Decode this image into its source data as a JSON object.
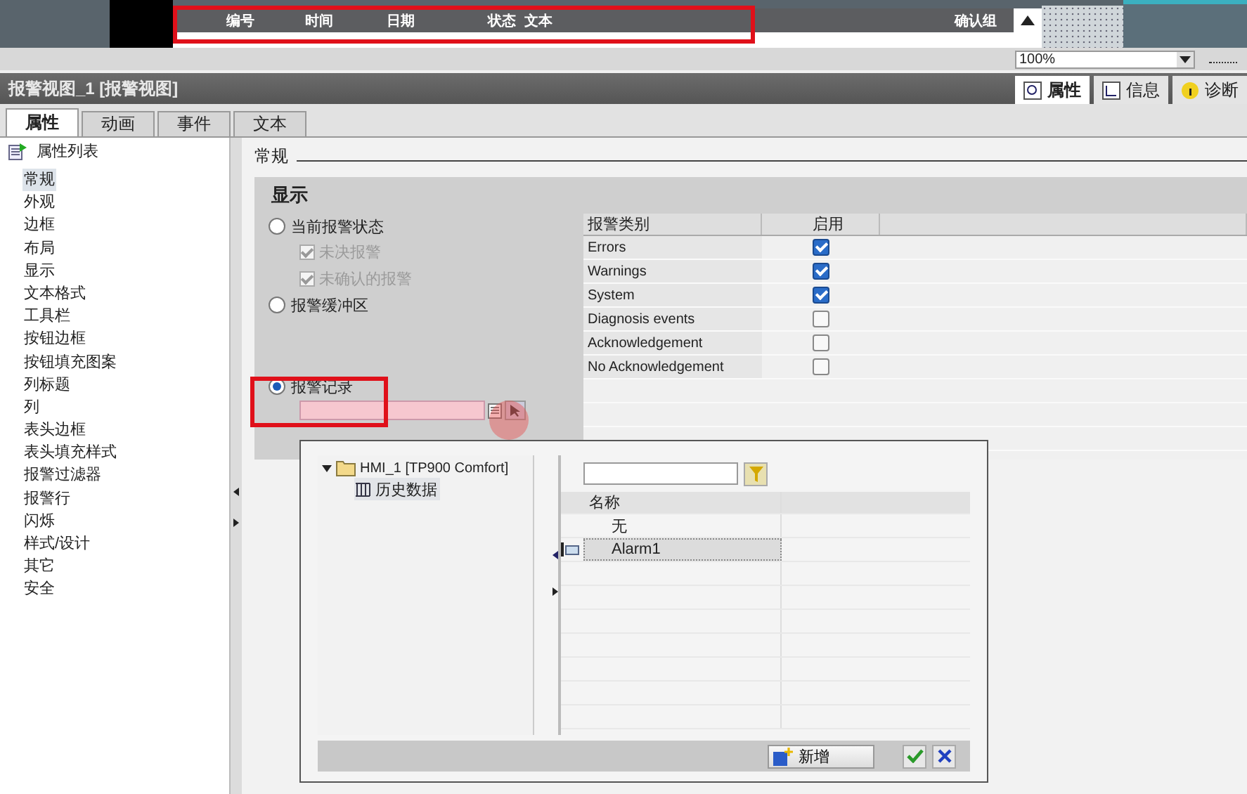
{
  "preview": {
    "columns": [
      "编号",
      "时间",
      "日期",
      "状态",
      "文本"
    ],
    "last_column": "确认组",
    "zoom": "100%"
  },
  "inspector": {
    "title": "报警视图_1 [报警视图]",
    "panel_tabs": [
      {
        "label": "属性",
        "selected": true
      },
      {
        "label": "信息",
        "selected": false
      },
      {
        "label": "诊断",
        "selected": false
      }
    ]
  },
  "tabs": [
    {
      "label": "属性",
      "selected": true
    },
    {
      "label": "动画",
      "selected": false
    },
    {
      "label": "事件",
      "selected": false
    },
    {
      "label": "文本",
      "selected": false
    }
  ],
  "sidebar": {
    "header": "属性列表",
    "items": [
      {
        "label": "常规",
        "selected": true
      },
      {
        "label": "外观",
        "selected": false
      },
      {
        "label": "边框",
        "selected": false
      },
      {
        "label": "布局",
        "selected": false
      },
      {
        "label": "显示",
        "selected": false
      },
      {
        "label": "文本格式",
        "selected": false
      },
      {
        "label": "工具栏",
        "selected": false
      },
      {
        "label": "按钮边框",
        "selected": false
      },
      {
        "label": "按钮填充图案",
        "selected": false
      },
      {
        "label": "列标题",
        "selected": false
      },
      {
        "label": "列",
        "selected": false
      },
      {
        "label": "表头边框",
        "selected": false
      },
      {
        "label": "表头填充样式",
        "selected": false
      },
      {
        "label": "报警过滤器",
        "selected": false
      },
      {
        "label": "报警行",
        "selected": false
      },
      {
        "label": "闪烁",
        "selected": false
      },
      {
        "label": "样式/设计",
        "selected": false
      },
      {
        "label": "其它",
        "selected": false
      },
      {
        "label": "安全",
        "selected": false
      }
    ]
  },
  "section": {
    "title": "常规",
    "group_title": "显示",
    "options": [
      {
        "label": "当前报警状态",
        "selected": false,
        "children": [
          {
            "label": "未决报警",
            "checked": true,
            "disabled": true
          },
          {
            "label": "未确认的报警",
            "checked": true,
            "disabled": true
          }
        ]
      },
      {
        "label": "报警缓冲区",
        "selected": false
      },
      {
        "label": "报警记录",
        "selected": true
      }
    ],
    "class_table": {
      "columns": [
        "报警类别",
        "启用"
      ],
      "rows": [
        {
          "name": "Errors",
          "checked": true
        },
        {
          "name": "Warnings",
          "checked": true
        },
        {
          "name": "System",
          "checked": true
        },
        {
          "name": "Diagnosis events",
          "checked": false
        },
        {
          "name": "Acknowledgement",
          "checked": false
        },
        {
          "name": "No Acknowledgement",
          "checked": false
        }
      ]
    }
  },
  "picker": {
    "tree": {
      "label": "HMI_1 [TP900 Comfort]",
      "expanded": true,
      "children": [
        {
          "label": "历史数据",
          "selected": true
        }
      ]
    },
    "list": {
      "columns": [
        "名称"
      ],
      "rows": [
        {
          "name": "无",
          "selected": false
        },
        {
          "name": "Alarm1",
          "selected": true
        }
      ]
    },
    "new_button": "新增"
  }
}
